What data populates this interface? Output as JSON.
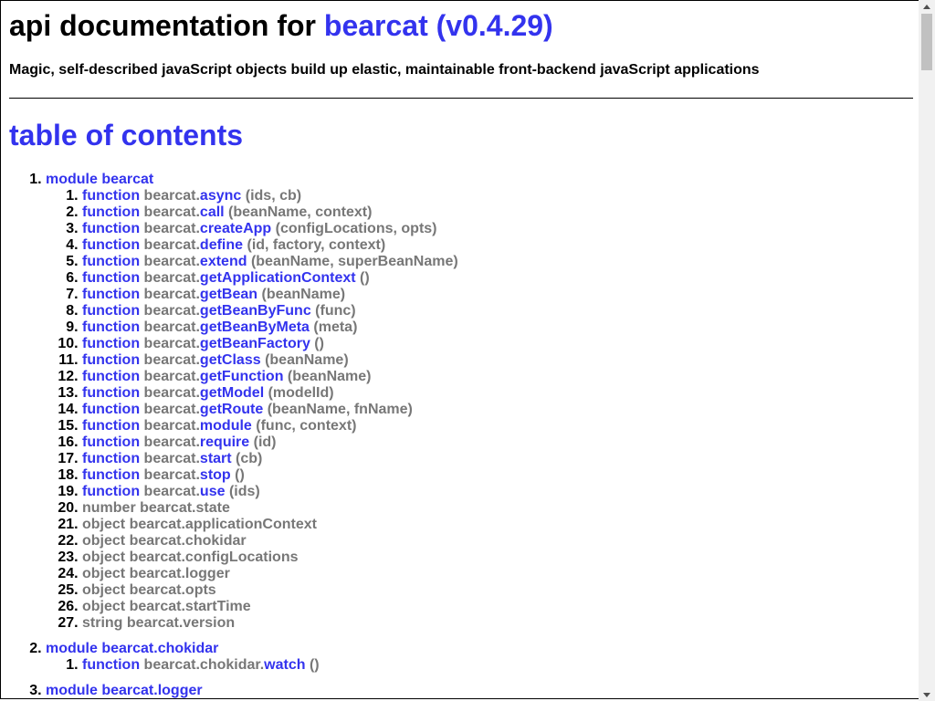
{
  "header": {
    "title_prefix": "api documentation for ",
    "title_link": "bearcat (v0.4.29)",
    "description": "Magic, self-described javaScript objects build up elastic, maintainable front-backend javaScript applications"
  },
  "toc": {
    "title": "table of contents",
    "modules": [
      {
        "label": "module bearcat",
        "items": [
          {
            "kind": "function",
            "owner": "bearcat.",
            "name": "async",
            "sig": " (ids, cb)"
          },
          {
            "kind": "function",
            "owner": "bearcat.",
            "name": "call",
            "sig": " (beanName, context)"
          },
          {
            "kind": "function",
            "owner": "bearcat.",
            "name": "createApp",
            "sig": " (configLocations, opts)"
          },
          {
            "kind": "function",
            "owner": "bearcat.",
            "name": "define",
            "sig": " (id, factory, context)"
          },
          {
            "kind": "function",
            "owner": "bearcat.",
            "name": "extend",
            "sig": " (beanName, superBeanName)"
          },
          {
            "kind": "function",
            "owner": "bearcat.",
            "name": "getApplicationContext",
            "sig": " ()"
          },
          {
            "kind": "function",
            "owner": "bearcat.",
            "name": "getBean",
            "sig": " (beanName)"
          },
          {
            "kind": "function",
            "owner": "bearcat.",
            "name": "getBeanByFunc",
            "sig": " (func)"
          },
          {
            "kind": "function",
            "owner": "bearcat.",
            "name": "getBeanByMeta",
            "sig": " (meta)"
          },
          {
            "kind": "function",
            "owner": "bearcat.",
            "name": "getBeanFactory",
            "sig": " ()"
          },
          {
            "kind": "function",
            "owner": "bearcat.",
            "name": "getClass",
            "sig": " (beanName)"
          },
          {
            "kind": "function",
            "owner": "bearcat.",
            "name": "getFunction",
            "sig": " (beanName)"
          },
          {
            "kind": "function",
            "owner": "bearcat.",
            "name": "getModel",
            "sig": " (modelId)"
          },
          {
            "kind": "function",
            "owner": "bearcat.",
            "name": "getRoute",
            "sig": " (beanName, fnName)"
          },
          {
            "kind": "function",
            "owner": "bearcat.",
            "name": "module",
            "sig": " (func, context)"
          },
          {
            "kind": "function",
            "owner": "bearcat.",
            "name": "require",
            "sig": " (id)"
          },
          {
            "kind": "function",
            "owner": "bearcat.",
            "name": "start",
            "sig": " (cb)"
          },
          {
            "kind": "function",
            "owner": "bearcat.",
            "name": "stop",
            "sig": " ()"
          },
          {
            "kind": "function",
            "owner": "bearcat.",
            "name": "use",
            "sig": " (ids)"
          },
          {
            "kind": "plain",
            "text": "number bearcat.state"
          },
          {
            "kind": "plain",
            "text": "object bearcat.applicationContext"
          },
          {
            "kind": "plain",
            "text": "object bearcat.chokidar"
          },
          {
            "kind": "plain",
            "text": "object bearcat.configLocations"
          },
          {
            "kind": "plain",
            "text": "object bearcat.logger"
          },
          {
            "kind": "plain",
            "text": "object bearcat.opts"
          },
          {
            "kind": "plain",
            "text": "object bearcat.startTime"
          },
          {
            "kind": "plain",
            "text": "string bearcat.version"
          }
        ]
      },
      {
        "label": "module bearcat.chokidar",
        "items": [
          {
            "kind": "function",
            "owner": "bearcat.chokidar.",
            "name": "watch",
            "sig": " ()"
          }
        ]
      },
      {
        "label": "module bearcat.logger",
        "items": []
      }
    ]
  },
  "labels": {
    "function_keyword": "function"
  },
  "icons": {
    "scroll_up": "triangle-up-icon",
    "scroll_down": "triangle-down-icon"
  },
  "colors": {
    "link": "#3333ee",
    "muted": "#777777"
  }
}
